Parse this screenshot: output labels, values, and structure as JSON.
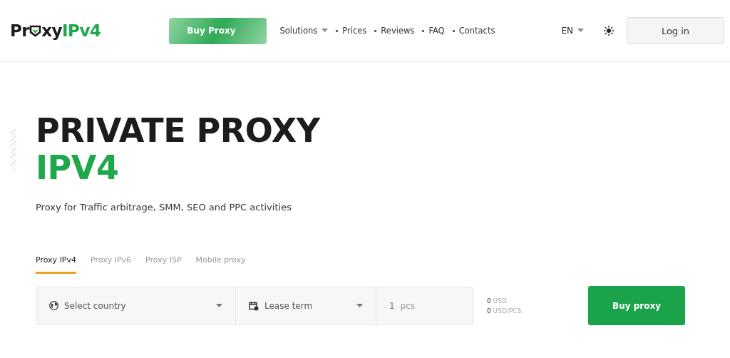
{
  "header": {
    "logo": {
      "start": "Pr",
      "end": "xy",
      "accent": "IPv4"
    },
    "buy_button": {
      "label": "Buy Proxy"
    },
    "nav": [
      {
        "label": "Solutions",
        "kind": "dropdown"
      },
      {
        "label": "Prices",
        "kind": "link"
      },
      {
        "label": "Reviews",
        "kind": "link"
      },
      {
        "label": "FAQ",
        "kind": "link"
      },
      {
        "label": "Contacts",
        "kind": "link"
      }
    ],
    "language": "EN",
    "login_button": "Log in"
  },
  "hero": {
    "title": "PRIVATE PROXY",
    "title_accent": "IPV4",
    "subtitle": "Proxy for Traffic arbitrage, SMM, SEO and PPC activities"
  },
  "tabs": [
    {
      "label": "Proxy IPv4",
      "selected": true
    },
    {
      "label": "Proxy IPv6",
      "selected": false
    },
    {
      "label": "Proxy ISP",
      "selected": false
    },
    {
      "label": "Mobile proxy",
      "selected": false
    }
  ],
  "order_form": {
    "country": {
      "placeholder": "Select country"
    },
    "lease_term": {
      "placeholder": "Lease term"
    },
    "quantity": {
      "value": "1",
      "unit": "pcs"
    },
    "totals": [
      {
        "amount": "0",
        "unit": "USD"
      },
      {
        "amount": "0",
        "unit": "USD/PCS."
      }
    ],
    "submit": "Buy proxy"
  }
}
